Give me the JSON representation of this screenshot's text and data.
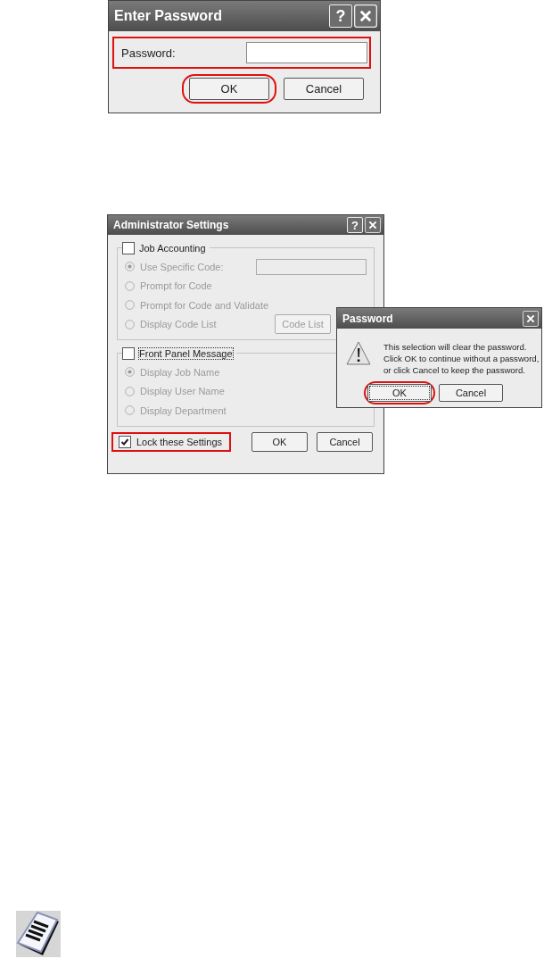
{
  "password_dialog": {
    "title": "Enter Password",
    "help_button": "?",
    "field": {
      "label": "Password:",
      "highlighted": true
    },
    "buttons": [
      {
        "label": "OK",
        "highlighted": true
      },
      {
        "label": "Cancel",
        "highlighted": false
      }
    ]
  },
  "admin_dialog": {
    "title": "Administrator Settings",
    "help_button": "?",
    "groups": [
      {
        "label": "Job Accounting",
        "checked": false,
        "focused": false,
        "options": [
          {
            "label": "Use Specific Code:",
            "selected": true,
            "disabled": true,
            "kind": "field"
          },
          {
            "label": "Prompt for Code",
            "selected": false,
            "disabled": true,
            "kind": "plain"
          },
          {
            "label": "Prompt for Code and Validate",
            "selected": false,
            "disabled": true,
            "kind": "plain"
          },
          {
            "label": "Display Code List",
            "selected": false,
            "disabled": true,
            "kind": "button",
            "button": "Code List"
          }
        ]
      },
      {
        "label": "Front Panel Message",
        "checked": false,
        "focused": true,
        "options": [
          {
            "label": "Display Job Name",
            "selected": true,
            "disabled": true,
            "kind": "plain"
          },
          {
            "label": "Display User Name",
            "selected": false,
            "disabled": true,
            "kind": "plain"
          },
          {
            "label": "Display Department",
            "selected": false,
            "disabled": true,
            "kind": "plain"
          }
        ]
      }
    ],
    "lock": {
      "label": "Lock these Settings",
      "checked": true,
      "highlighted": true
    },
    "buttons": [
      {
        "label": "OK",
        "highlighted": false
      },
      {
        "label": "Cancel",
        "highlighted": false
      }
    ]
  },
  "confirm_dialog": {
    "title": "Password",
    "message_lines": [
      "This selection will clear the password.",
      "Click OK to continue without a password,",
      "or click Cancel to keep the password."
    ],
    "buttons": [
      {
        "label": "OK",
        "highlighted": true,
        "focused": true
      },
      {
        "label": "Cancel",
        "highlighted": false,
        "focused": false
      }
    ]
  }
}
